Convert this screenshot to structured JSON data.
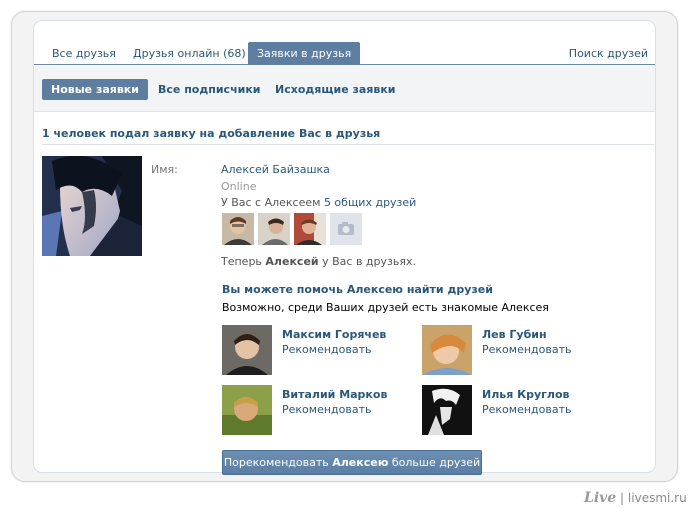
{
  "tabs": [
    {
      "label": "Все друзья",
      "active": false
    },
    {
      "label": "Друзья онлайн (68)",
      "active": false
    },
    {
      "label": "Заявки в друзья",
      "active": true
    }
  ],
  "search_link": "Поиск друзей",
  "subtabs": [
    {
      "label": "Новые заявки",
      "active": true
    },
    {
      "label": "Все подписчики",
      "active": false
    },
    {
      "label": "Исходящие заявки",
      "active": false
    }
  ],
  "section_title": "1 человек подал заявку на добавление Вас в друзья",
  "request": {
    "name_label": "Имя:",
    "name": "Алексей Байзашка",
    "status": "Online",
    "mutual_prefix": "У Вас с Алексеем",
    "mutual_link": "5 общих друзей",
    "now_prefix": "Теперь",
    "now_name": "Алексей",
    "now_suffix": "у Вас в друзьях."
  },
  "help": {
    "title": "Вы можете помочь Алексею найти друзей",
    "subtitle": "Возможно, среди Ваших друзей есть знакомые Алексея"
  },
  "recommendations": [
    {
      "name": "Максим Горячев",
      "action": "Рекомендовать"
    },
    {
      "name": "Лев Губин",
      "action": "Рекомендовать"
    },
    {
      "name": "Виталий Марков",
      "action": "Рекомендовать"
    },
    {
      "name": "Илья Круглов",
      "action": "Рекомендовать"
    }
  ],
  "recommend_button": {
    "prefix": "Порекомендовать",
    "name": "Алексею",
    "suffix": "больше друзей"
  },
  "watermark": {
    "logo": "Live",
    "sep": "|",
    "site": "livesmi.ru"
  },
  "colors": {
    "accent": "#5d7ea0",
    "link": "#2b587a",
    "tab_border": "#6a87a6"
  }
}
